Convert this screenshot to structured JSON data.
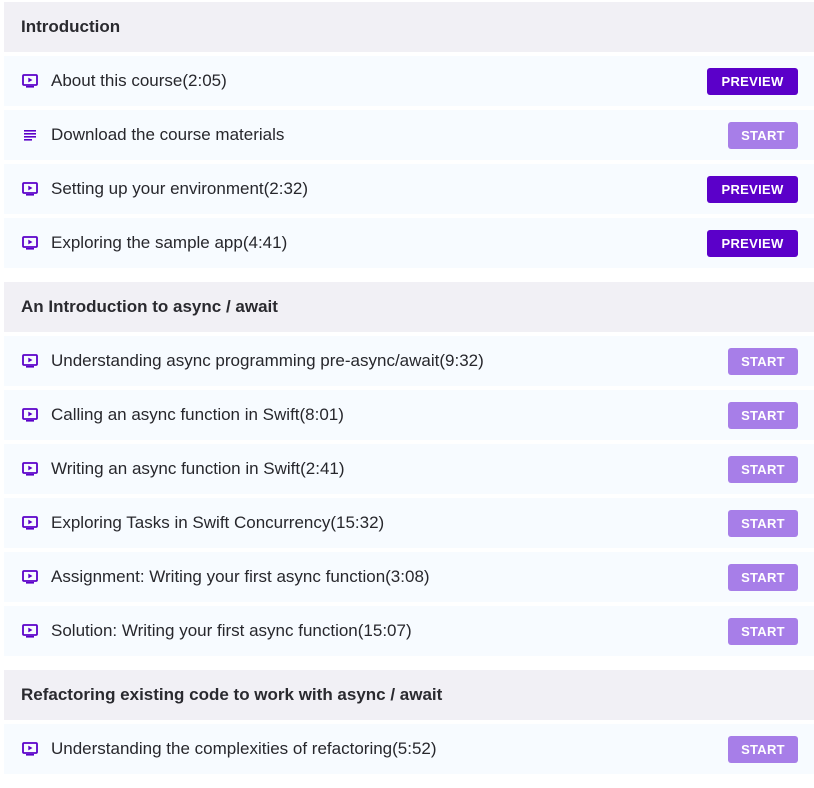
{
  "colors": {
    "accent_dark": "#5b00c9",
    "accent_light": "#a77ee8",
    "section_bg": "#f1f0f5",
    "row_bg": "#f7fbff"
  },
  "sections": [
    {
      "title": "Introduction",
      "lectures": [
        {
          "icon": "play-video-icon",
          "title": "About this course(2:05)",
          "action": "PREVIEW"
        },
        {
          "icon": "text-document-icon",
          "title": "Download the course materials",
          "action": "START"
        },
        {
          "icon": "play-video-icon",
          "title": "Setting up your environment(2:32)",
          "action": "PREVIEW"
        },
        {
          "icon": "play-video-icon",
          "title": "Exploring the sample app(4:41)",
          "action": "PREVIEW"
        }
      ]
    },
    {
      "title": "An Introduction to async / await",
      "lectures": [
        {
          "icon": "play-video-icon",
          "title": "Understanding async programming pre-async/await(9:32)",
          "action": "START"
        },
        {
          "icon": "play-video-icon",
          "title": "Calling an async function in Swift(8:01)",
          "action": "START"
        },
        {
          "icon": "play-video-icon",
          "title": "Writing an async function in Swift(2:41)",
          "action": "START"
        },
        {
          "icon": "play-video-icon",
          "title": "Exploring Tasks in Swift Concurrency(15:32)",
          "action": "START"
        },
        {
          "icon": "play-video-icon",
          "title": "Assignment: Writing your first async function(3:08)",
          "action": "START"
        },
        {
          "icon": "play-video-icon",
          "title": "Solution: Writing your first async function(15:07)",
          "action": "START"
        }
      ]
    },
    {
      "title": "Refactoring existing code to work with async / await",
      "lectures": [
        {
          "icon": "play-video-icon",
          "title": "Understanding the complexities of refactoring(5:52)",
          "action": "START"
        }
      ]
    }
  ]
}
